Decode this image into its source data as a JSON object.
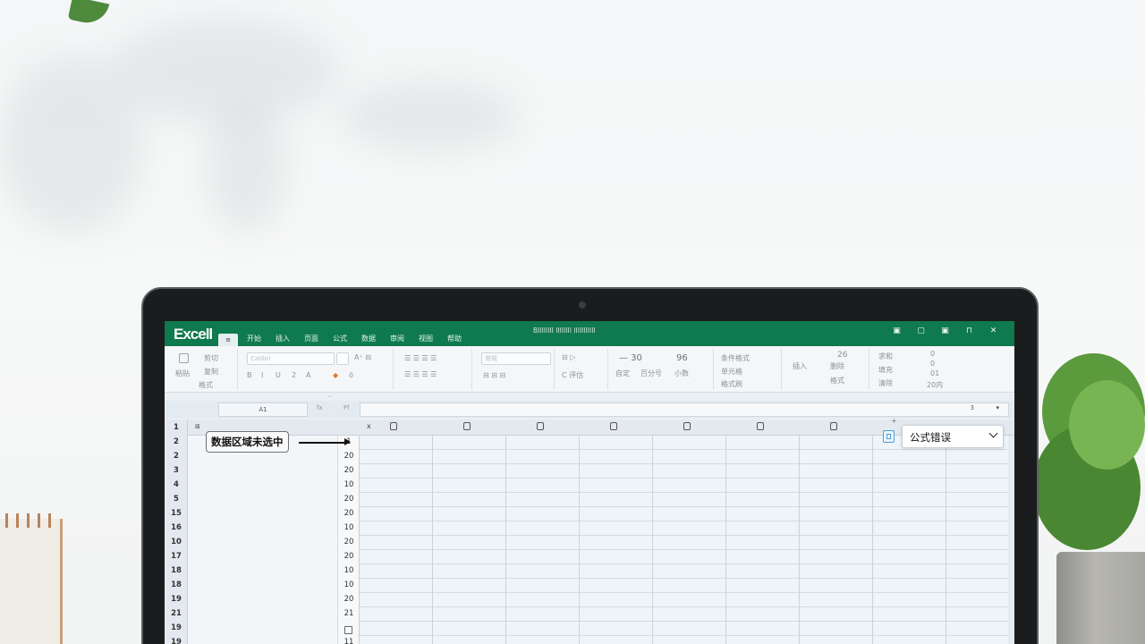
{
  "app": {
    "logo": "Excell",
    "file_tab": "≡",
    "window_title": "BIIIIIIII IIIIIIII IIIIIIIIIII",
    "window_controls": [
      "▣",
      "▢",
      "▣",
      "⊓",
      "✕"
    ]
  },
  "menu": [
    "开始",
    "插入",
    "页面",
    "公式",
    "数据",
    "审阅",
    "视图",
    "帮助"
  ],
  "ribbon": {
    "clipboard": [
      "粘贴",
      "剪切",
      "复制",
      "格式"
    ],
    "font_box": "Calibri",
    "font_row": [
      "B",
      "I",
      "U",
      "2",
      "A",
      "ö"
    ],
    "number_box": "常规",
    "number_row": [
      "— 30",
      "96"
    ],
    "number_sub": [
      "自定",
      "百分号",
      "小数"
    ],
    "styles": [
      "条件格式",
      "单元格",
      "格式刷"
    ],
    "cells": [
      "26",
      "插入",
      "删除",
      "格式"
    ],
    "editing": [
      "求和",
      "填充",
      "清除"
    ],
    "editing_vals": [
      "0",
      "0",
      "01",
      "20内"
    ]
  },
  "formula_bar": {
    "name_box": "A1",
    "fx": "fx",
    "label": "Ff",
    "value_right": "3",
    "dropdown": "▾"
  },
  "grid": {
    "col_header_x": "x",
    "row_numbers": [
      "1",
      "2",
      "2",
      "3",
      "4",
      "5",
      "15",
      "16",
      "10",
      "17",
      "18",
      "18",
      "19",
      "21",
      "19",
      "19"
    ],
    "values": [
      "",
      "1",
      "20",
      "20",
      "10",
      "20",
      "20",
      "10",
      "20",
      "20",
      "10",
      "10",
      "20",
      "21",
      "",
      "11"
    ],
    "callout": "数据区域未选中",
    "error_dropdown": "公式错误"
  },
  "colors": {
    "titlebar": "#0f7a4d",
    "grid_bg": "#eef4f8",
    "accent": "#4f9fd0"
  }
}
